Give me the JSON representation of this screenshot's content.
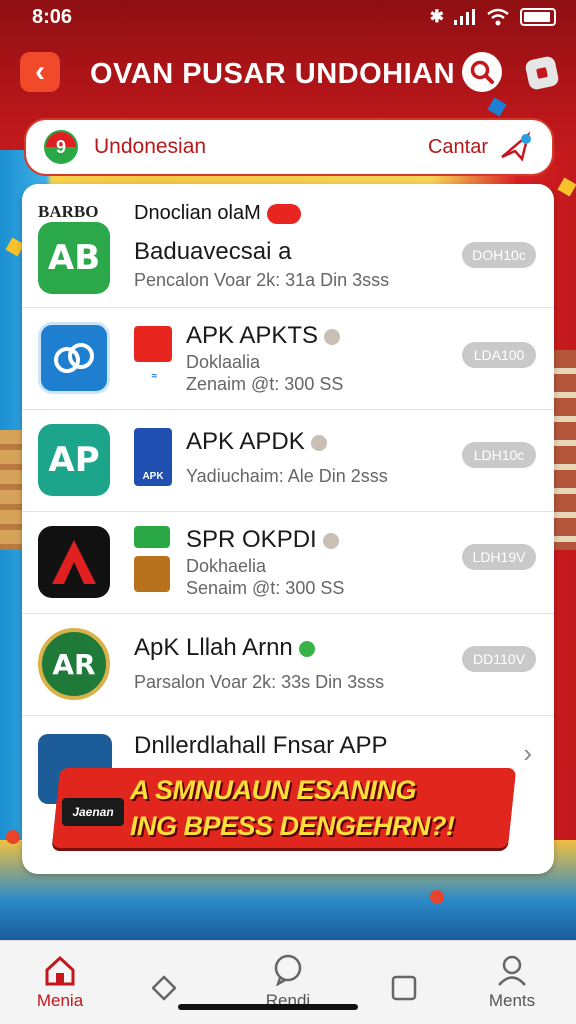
{
  "status_bar": {
    "time": "8:06"
  },
  "header": {
    "back_glyph": "‹",
    "title": "OVAN PUSAR UNDOHIAN"
  },
  "region": {
    "flag_glyph": "9",
    "label": "Undonesian",
    "action": "Cantar"
  },
  "featured": {
    "tag": "BARBO",
    "heading": "Dnoclian olaM",
    "icon_text": "AB",
    "name": "Baduavecsai a",
    "meta": "Pencalon Voar 2k: 31a Din 3sss",
    "pill": "DOH10c"
  },
  "apps": [
    {
      "icon_text": "",
      "name": "APK APKTS",
      "sub": "Doklaalia",
      "meta": "Zenaim @t: 300 SS",
      "pill": "LDA100"
    },
    {
      "icon_text": "AP",
      "mini_label": "APK",
      "name": "APK APDK",
      "meta": "Yadiuchaim: Ale Din 2sss",
      "pill": "LDH10c"
    },
    {
      "icon_text": "",
      "name": "SPR OKPDI",
      "sub": "Dokhaelia",
      "meta": "Senaim @t: 300 SS",
      "pill": "LDH19V"
    },
    {
      "icon_text": "AR",
      "name": "ApK Lllah Arnn",
      "meta": "Parsalon Voar 2k: 33s Din 3sss",
      "pill": "DD110V"
    }
  ],
  "more_row": {
    "label": "Dnllerdlahall Fnsar APP",
    "chevron": "›"
  },
  "promo": {
    "tag": "Jaenan",
    "line1": "A SMNUAUN ESANING",
    "line2": "ING BPESS DENGEHRN?!"
  },
  "nav": [
    {
      "label": "Menia",
      "icon": "home-icon"
    },
    {
      "label": "",
      "icon": "tag-icon"
    },
    {
      "label": "Rendi",
      "icon": "chat-icon"
    },
    {
      "label": "",
      "icon": "square-icon"
    },
    {
      "label": "Ments",
      "icon": "user-icon"
    }
  ],
  "colors": {
    "brand_red": "#c4161c",
    "accent_orange": "#f04a2a",
    "promo_yellow": "#ffe03b",
    "pill_gray": "#c9c9c9"
  }
}
